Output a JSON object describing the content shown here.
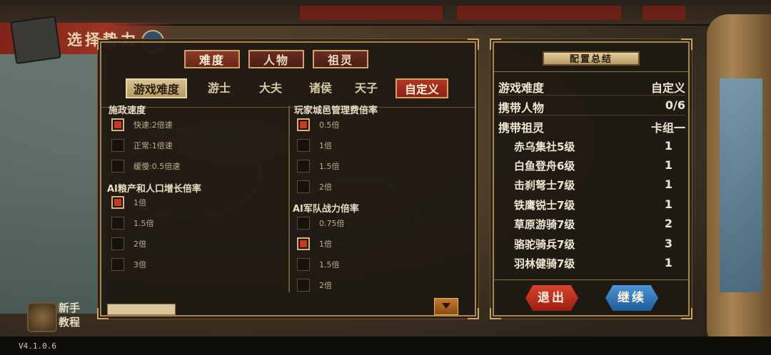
{
  "header": {
    "title": "选择势力"
  },
  "tutorial": {
    "label_line1": "新手",
    "label_line2": "教程"
  },
  "version": "V4.1.0.6",
  "settings_panel": {
    "top_tabs": [
      "难度",
      "人物",
      "祖灵"
    ],
    "active_top_tab": "难度",
    "sub_tabs": [
      "游戏难度",
      "游士",
      "大夫",
      "诸侯",
      "天子",
      "自定义"
    ],
    "selected_sub_tab": "自定义",
    "left_column": [
      {
        "title": "施政速度",
        "options": [
          "快速:2倍速",
          "正常:1倍速",
          "缓慢:0.5倍速"
        ],
        "selected_index": 0
      },
      {
        "title": "AI粮产和人口增长倍率",
        "options": [
          "1倍",
          "1.5倍",
          "2倍",
          "3倍"
        ],
        "selected_index": 0
      }
    ],
    "right_column": [
      {
        "title": "玩家城邑管理费倍率",
        "options": [
          "0.5倍",
          "1倍",
          "1.5倍",
          "2倍"
        ],
        "selected_index": 0
      },
      {
        "title": "AI军队战力倍率",
        "options": [
          "0.75倍",
          "1倍",
          "1.5倍",
          "2倍"
        ],
        "selected_index": 1
      }
    ]
  },
  "summary_panel": {
    "title": "配置总结",
    "rows": [
      {
        "key": "游戏难度",
        "value": "自定义"
      },
      {
        "key": "携带人物",
        "value": "0/6"
      },
      {
        "key": "携带祖灵",
        "value": "卡组一"
      }
    ],
    "units": [
      {
        "name": "赤乌集社5级",
        "count": "1"
      },
      {
        "name": "白鱼登舟6级",
        "count": "1"
      },
      {
        "name": "击刹弩士7级",
        "count": "1"
      },
      {
        "name": "铁鹰锐士7级",
        "count": "1"
      },
      {
        "name": "草原游骑7级",
        "count": "2"
      },
      {
        "name": "骆驼骑兵7级",
        "count": "3"
      },
      {
        "name": "羽林健骑7级",
        "count": "1"
      }
    ],
    "exit_label": "退出",
    "continue_label": "继续"
  }
}
